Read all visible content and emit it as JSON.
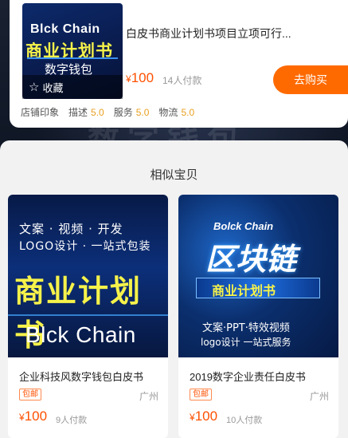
{
  "top_product": {
    "thumb_line1": "Blck Chain",
    "thumb_line2": "商业计划书",
    "thumb_line3": "数字钱包",
    "favorite_label": "收藏",
    "title": "白皮书商业计划书项目立项可行...",
    "currency": "¥",
    "price": "100",
    "paid_count": "14人付款",
    "buy_label": "去购买"
  },
  "shop_ratings": {
    "shop_label": "店铺印象",
    "items": [
      {
        "label": "描述",
        "value": "5.0"
      },
      {
        "label": "服务",
        "value": "5.0"
      },
      {
        "label": "物流",
        "value": "5.0"
      }
    ]
  },
  "similar": {
    "title": "相似宝贝",
    "items": [
      {
        "img_lines": [
          "文案 · 视频 · 开发",
          "LOGO设计 · 一站式包装",
          "商业计划书",
          "Blck Chain"
        ],
        "name": "企业科技风数字钱包白皮书",
        "tag": "包邮",
        "location": "广州",
        "currency": "¥",
        "price": "100",
        "paid_count": "9人付款"
      },
      {
        "img_lines": [
          "Bolck Chain",
          "区块链",
          "商业计划书",
          "文案·PPT·特效视频",
          "logo设计  一站式服务"
        ],
        "name": "2019数字企业责任白皮书",
        "tag": "包邮",
        "location": "广州",
        "currency": "¥",
        "price": "100",
        "paid_count": "10人付款"
      }
    ]
  },
  "colors": {
    "accent": "#ff5000",
    "buy_button": "#ff6a00",
    "rating_value": "#e8a020"
  }
}
